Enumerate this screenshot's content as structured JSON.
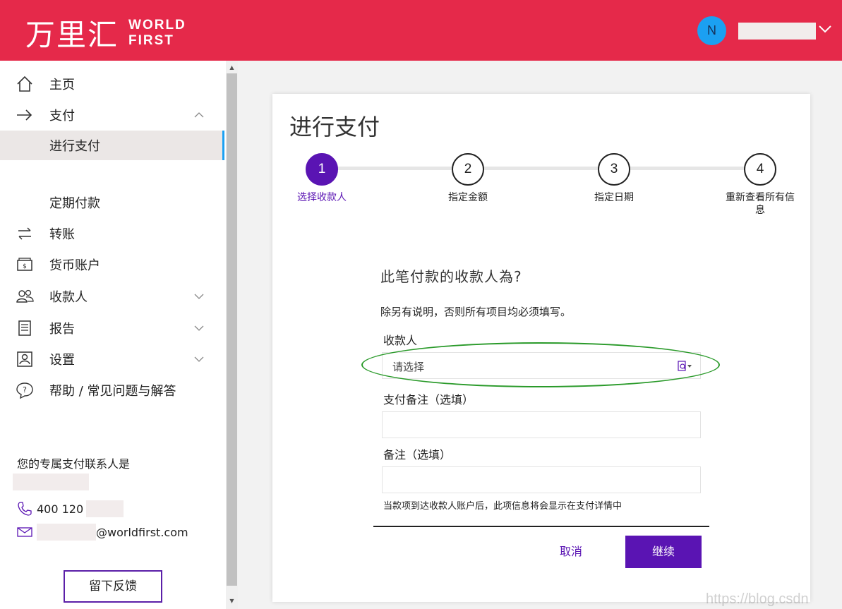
{
  "header": {
    "logo_cn": "万里汇",
    "logo_en_line1": "WORLD",
    "logo_en_line2": "FIRST",
    "avatar_initial": "N",
    "brand_color": "#e5294a"
  },
  "sidebar": {
    "items": [
      {
        "label": "主页",
        "icon": "home-icon"
      },
      {
        "label": "支付",
        "icon": "arrow-right-icon"
      },
      {
        "label": "进行支付",
        "icon": ""
      },
      {
        "label": "定期付款",
        "icon": ""
      },
      {
        "label": "转账",
        "icon": "transfer-icon"
      },
      {
        "label": "货币账户",
        "icon": "wallet-icon"
      },
      {
        "label": "收款人",
        "icon": "payees-icon"
      },
      {
        "label": "报告",
        "icon": "report-icon"
      },
      {
        "label": "设置",
        "icon": "settings-icon"
      },
      {
        "label": "帮助 / 常见问题与解答",
        "icon": "help-icon"
      }
    ],
    "contact_title": "您的专属支付联系人是",
    "phone_prefix": "400 120",
    "email_domain": "@worldfirst.com",
    "feedback_label": "留下反馈"
  },
  "main": {
    "title": "进行支付",
    "steps": [
      {
        "number": "1",
        "label": "选择收款人"
      },
      {
        "number": "2",
        "label": "指定金额"
      },
      {
        "number": "3",
        "label": "指定日期"
      },
      {
        "number": "4",
        "label": "重新查看所有信息"
      }
    ],
    "question": "此笔付款的收款人為?",
    "required_note": "除另有说明，否则所有项目均必须填写。",
    "payee_label": "收款人",
    "payee_placeholder": "请选择",
    "payment_ref_label": "支付备注（选填）",
    "memo_label": "备注（选填）",
    "memo_hint": "当款项到达收款人账户后，此项信息将会显示在支付详情中",
    "cancel_label": "取消",
    "continue_label": "继续",
    "accent_color": "#5a14b3"
  },
  "watermark": "https://blog.csdn"
}
